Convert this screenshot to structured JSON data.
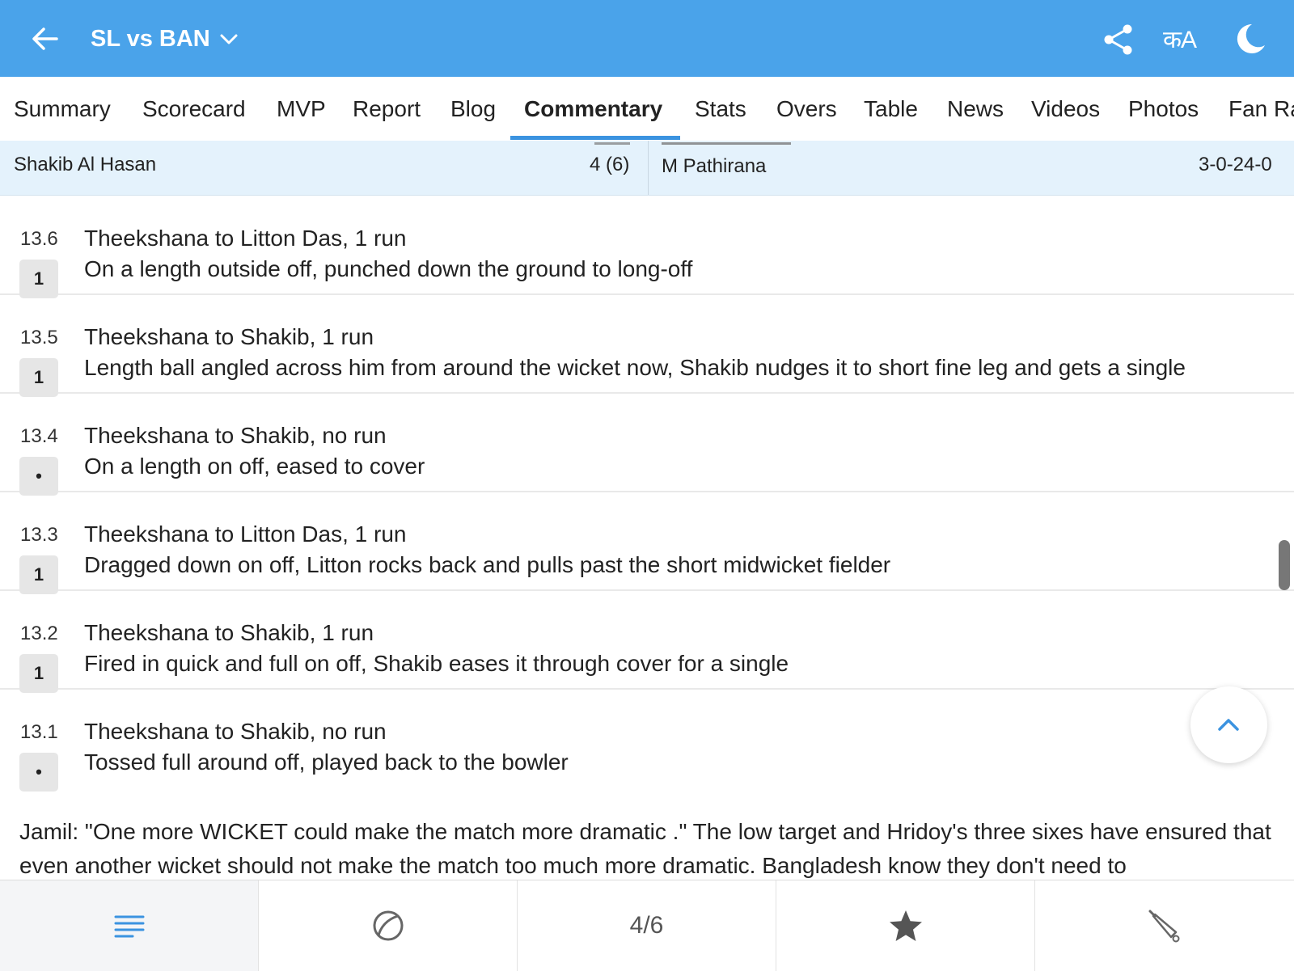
{
  "header": {
    "title": "SL vs BAN",
    "lang_label": "कA"
  },
  "tabs": [
    "Summary",
    "Scorecard",
    "MVP",
    "Report",
    "Blog",
    "Commentary",
    "Stats",
    "Overs",
    "Table",
    "News",
    "Videos",
    "Photos",
    "Fan Ra"
  ],
  "active_tab": "Commentary",
  "batting": {
    "name": "Shakib Al Hasan",
    "score": "4 (6)"
  },
  "bowling": {
    "name": "M Pathirana",
    "figures": "3-0-24-0"
  },
  "balls": [
    {
      "over": "13.6",
      "badge": "1",
      "head": "Theekshana to Litton Das, 1 run",
      "text": "On a length outside off, punched down the ground to long-off"
    },
    {
      "over": "13.5",
      "badge": "1",
      "head": "Theekshana to Shakib, 1 run",
      "text": "Length ball angled across him from around the wicket now, Shakib nudges it to short fine leg and gets a single"
    },
    {
      "over": "13.4",
      "badge": "•",
      "head": "Theekshana to Shakib, no run",
      "text": "On a length on off, eased to cover"
    },
    {
      "over": "13.3",
      "badge": "1",
      "head": "Theekshana to Litton Das, 1 run",
      "text": "Dragged down on off, Litton rocks back and pulls past the short midwicket fielder"
    },
    {
      "over": "13.2",
      "badge": "1",
      "head": "Theekshana to Shakib, 1 run",
      "text": "Fired in quick and full on off, Shakib eases it through cover for a single"
    },
    {
      "over": "13.1",
      "badge": "•",
      "head": "Theekshana to Shakib, no run",
      "text": "Tossed full around off, played back to the bowler"
    }
  ],
  "note": "Jamil: \"One more WICKET could make the match more dramatic .\" The low target and Hridoy's three sixes have ensured that even another wicket should not make the match too much more dramatic. Bangladesh know they don't need to",
  "bottom_nav": {
    "page_indicator": "4/6",
    "icons": [
      "menu-icon",
      "cricket-ball-icon",
      "page-indicator",
      "star-icon",
      "cricket-bat-icon"
    ]
  },
  "colors": {
    "header_bg": "#4aa3ea",
    "accent": "#3b93e0",
    "strip_bg": "#e4f2fc"
  }
}
